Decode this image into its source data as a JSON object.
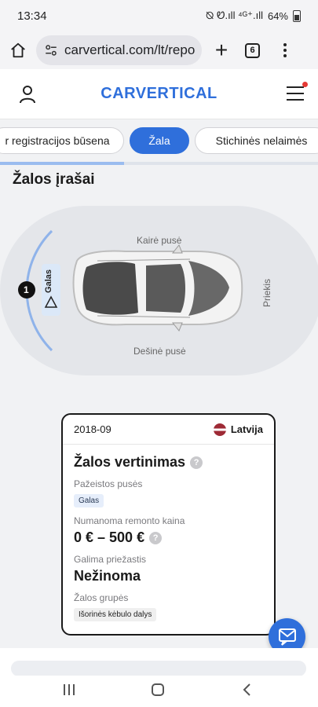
{
  "status_bar": {
    "time": "13:34",
    "icons_text": "⦰ Ꮼ.ıll ⁴ᴳ⁺.ıll",
    "battery": "64%"
  },
  "browser": {
    "url": "carvertical.com/lt/repo",
    "tab_count": "6"
  },
  "site": {
    "logo": "CARVERTICAL"
  },
  "tabs": {
    "items": [
      {
        "label": "r registracijos būsena",
        "active": false
      },
      {
        "label": "Žala",
        "active": true
      },
      {
        "label": "Stichinės nelaimės",
        "active": false
      }
    ],
    "scroll_progress": 0.39
  },
  "section": {
    "title": "Žalos įrašai"
  },
  "diagram": {
    "left_side": "Kairė pusė",
    "right_side": "Dešinė pusė",
    "front": "Priekis",
    "marker_number": "1",
    "marker_label": "Galas"
  },
  "record": {
    "date": "2018-09",
    "country": "Latvija",
    "title": "Žalos vertinimas",
    "damaged_sides_label": "Pažeistos pusės",
    "damaged_side": "Galas",
    "cost_label": "Numanoma remonto kaina",
    "cost_value": "0 € – 500 €",
    "cause_label": "Galima priežastis",
    "cause_value": "Nežinoma",
    "groups_label": "Žalos grupės",
    "group_value": "Išorinės kėbulo dalys"
  },
  "colors": {
    "accent": "#2f6fdb",
    "background": "#f1f2f4"
  }
}
